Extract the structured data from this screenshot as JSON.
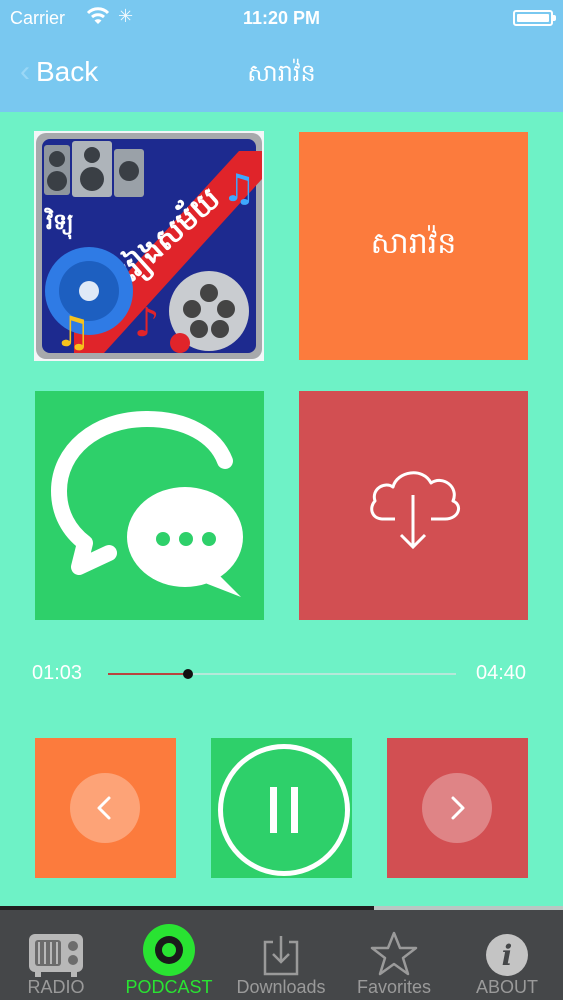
{
  "status_bar": {
    "carrier": "Carrier",
    "time": "11:20 PM"
  },
  "nav": {
    "back_label": "Back",
    "title": "សារាវ៉ន"
  },
  "tiles": {
    "title_tile_text": "សារាវ៉ន",
    "cover_art_text": "ចំរៀងសម័យ",
    "cover_logo_text": "វិទ្យុ"
  },
  "player": {
    "elapsed": "01:03",
    "total": "04:40",
    "progress": 0.23
  },
  "tabs": [
    {
      "label": "RADIO",
      "icon": "radio-icon",
      "active": false
    },
    {
      "label": "PODCAST",
      "icon": "podcast-icon",
      "active": true
    },
    {
      "label": "Downloads",
      "icon": "downloads-icon",
      "active": false
    },
    {
      "label": "Favorites",
      "icon": "star-icon",
      "active": false
    },
    {
      "label": "ABOUT",
      "icon": "info-icon",
      "active": false
    }
  ],
  "tabbar_progress": 0.665,
  "colors": {
    "nav_bar": "#79c8f0",
    "background": "#6ef2c6",
    "orange": "#fc7b3d",
    "green": "#2ed06a",
    "red": "#d24f52",
    "active_tab": "#29e332"
  }
}
